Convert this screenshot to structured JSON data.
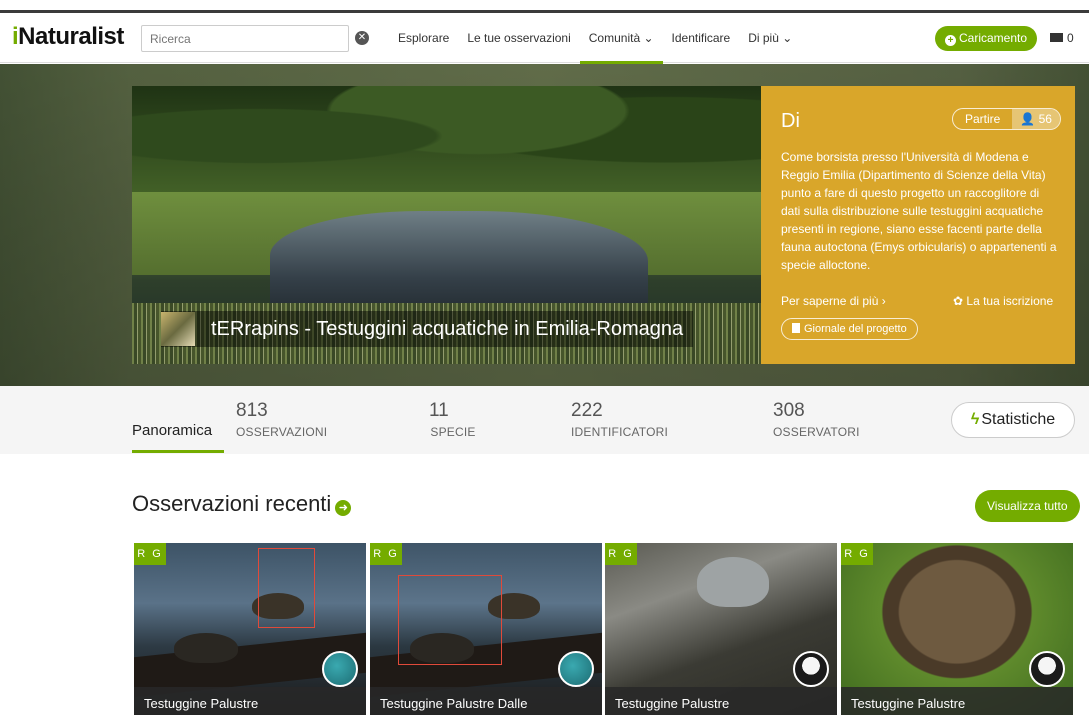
{
  "nav": {
    "logo_i": "i",
    "logo_rest": "Naturalist",
    "search_placeholder": "Ricerca",
    "items": [
      "Esplorare",
      "Le tue osservazioni",
      "Comunità ⌄",
      "Identificare",
      "Di più ⌄"
    ],
    "upload_label": "Caricamento",
    "mail_count": "0"
  },
  "project": {
    "title": "tERrapins - Testuggini acquatiche in Emilia-Romagna",
    "about_heading": "Di",
    "join_label": "Partire",
    "member_count": "56",
    "description": "Come borsista presso l'Università di Modena e Reggio Emilia (Dipartimento di Scienze della Vita) punto a fare di questo progetto un raccoglitore di dati sulla distribuzione sulle testuggini acquatiche presenti in regione, siano esse facenti parte della fauna autoctona (Emys orbicularis) o appartenenti a specie alloctone.",
    "more_link": "Per saperne di più ›",
    "membership_link": "La tua iscrizione",
    "journal_label": "Giornale del progetto"
  },
  "stats": {
    "tab_label": "Panoramica",
    "observations": {
      "value": "813",
      "label": "OSSERVAZIONI"
    },
    "species": {
      "value": "11",
      "label": "SPECIE"
    },
    "identifiers": {
      "value": "222",
      "label": "IDENTIFICATORI"
    },
    "observers": {
      "value": "308",
      "label": "OSSERVATORI"
    },
    "stats_button": "Statistiche"
  },
  "recent": {
    "title": "Osservazioni recenti",
    "view_all": "Visualizza tutto",
    "items": [
      {
        "badge": "R G",
        "name": "Testuggine Palustre"
      },
      {
        "badge": "R G",
        "name": "Testuggine Palustre Dalle"
      },
      {
        "badge": "R G",
        "name": "Testuggine Palustre"
      },
      {
        "badge": "R G",
        "name": "Testuggine Palustre"
      }
    ]
  },
  "colors": {
    "brand_green": "#74ac00",
    "about_panel": "#d9a62a"
  }
}
